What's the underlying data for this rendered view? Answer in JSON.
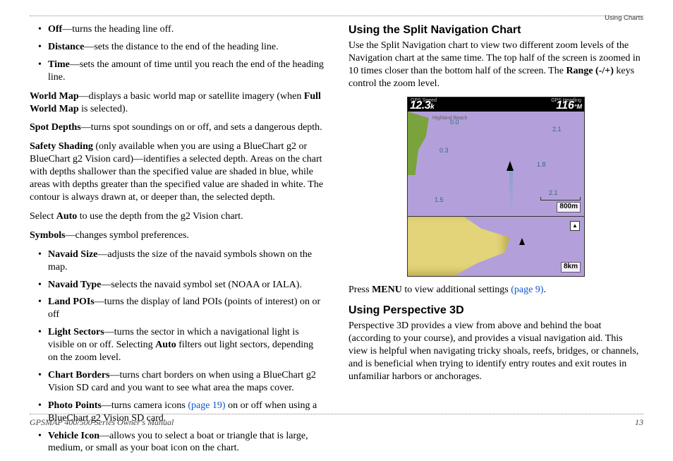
{
  "header": {
    "section": "Using Charts"
  },
  "left": {
    "bullets1": [
      {
        "term": "Off",
        "desc": "—turns the heading line off."
      },
      {
        "term": "Distance",
        "desc": "—sets the distance to the end of the heading line."
      },
      {
        "term": "Time",
        "desc": "—sets the amount of time until you reach the end of the heading line."
      }
    ],
    "worldmap_term": "World Map",
    "worldmap_desc_a": "—displays a basic world map or satellite imagery (when ",
    "worldmap_bold": "Full World Map",
    "worldmap_desc_b": " is selected).",
    "spot_term": "Spot Depths",
    "spot_desc": "—turns spot soundings on or off, and sets a dangerous depth.",
    "shading_term": "Safety Shading",
    "shading_desc": " (only available when you are using a BlueChart g2 or BlueChart g2 Vision card)—identifies a selected depth. Areas on the chart with depths shallower than the specified value are shaded in blue, while areas with depths greater than the specified value are shaded in white. The contour is always drawn at, or deeper than, the selected depth.",
    "select_a": "Select ",
    "select_bold": "Auto",
    "select_b": " to use the depth from the g2 Vision chart.",
    "symbols_term": "Symbols",
    "symbols_desc": "—changes symbol preferences.",
    "bullets2": [
      {
        "term": "Navaid Size",
        "desc": "—adjusts the size of the navaid symbols shown on the map."
      },
      {
        "term": "Navaid Type",
        "desc": "—selects the navaid symbol set (NOAA or IALA)."
      },
      {
        "term": "Land POIs",
        "desc": "—turns the display of land POIs (points of interest) on or off"
      },
      {
        "term": "Light Sectors",
        "desc_a": "—turns the sector in which a navigational light is visible on or off. Selecting ",
        "bold": "Auto",
        "desc_b": " filters out light sectors, depending on the zoom level."
      },
      {
        "term": "Chart Borders",
        "desc": "—turns chart borders on when using a BlueChart g2 Vision SD card and you want to see what area the maps cover."
      },
      {
        "term": "Photo Points",
        "desc_a": "—turns camera icons ",
        "link": "(page 19)",
        "desc_b": " on or off when using a BlueChart g2 Vision SD card."
      },
      {
        "term": "Vehicle Icon",
        "desc": "—allows you to select a boat or triangle that is large, medium, or small as your boat icon on the chart."
      }
    ]
  },
  "right": {
    "h_split": "Using the Split Navigation Chart",
    "split_a": "Use the Split Navigation chart to view two different zoom levels of the Navigation chart at the same time. The top half of the screen is zoomed in 10 times closer than the bottom half of the screen. The ",
    "split_bold": "Range (-/+)",
    "split_b": " keys control the zoom level.",
    "menu_a": "Press ",
    "menu_bold": "MENU",
    "menu_b": " to view additional settings ",
    "menu_link": "(page 9)",
    "menu_c": ".",
    "h_p3d": "Using Perspective 3D",
    "p3d": "Perspective 3D provides a view from above and behind the boat (according to your course), and provides a visual navigation aid. This view is helpful when navigating tricky shoals, reefs, bridges, or channels, and is beneficial when trying to identify entry routes and exit routes in unfamiliar harbors or anchorages."
  },
  "figure": {
    "speed_label": "GPS Speed",
    "speed_val": "12.3",
    "speed_unit": "k",
    "heading_label": "GPS Heading",
    "heading_val": "116",
    "heading_unit": "°M",
    "beach": "Highland Beach",
    "d1": "0.0",
    "d2": "0.3",
    "d3": "1.5",
    "d4": "2.1",
    "d5": "1.8",
    "d6": "2.1",
    "range_top": "800m",
    "range_bottom": "8km",
    "north": "▲"
  },
  "footer": {
    "left": "GPSMAP 400/500 Series Owner's Manual",
    "right": "13"
  }
}
